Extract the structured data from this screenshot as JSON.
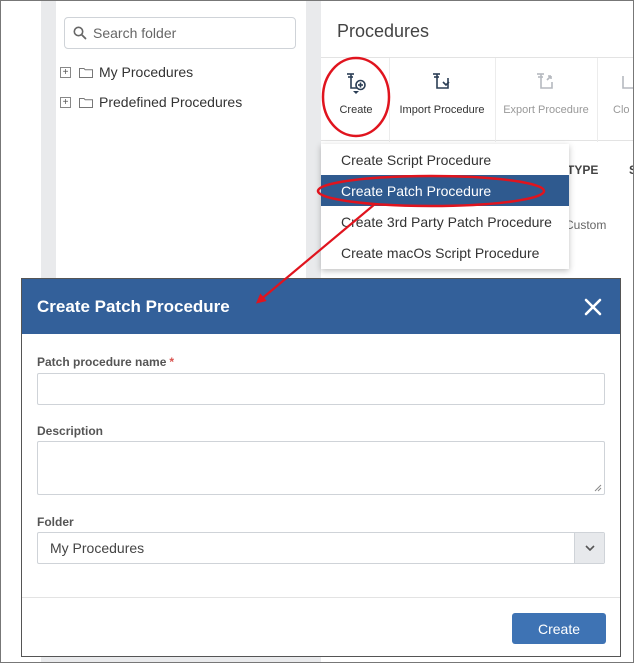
{
  "sidebar": {
    "search_placeholder": "Search folder",
    "tree": [
      {
        "label": "My Procedures",
        "expander": "+"
      },
      {
        "label": "Predefined Procedures",
        "expander": "+"
      }
    ]
  },
  "main": {
    "title": "Procedures",
    "toolbar": {
      "create": "Create",
      "import": "Import Procedure",
      "export": "Export Procedure",
      "clone": "Clo"
    },
    "columns": {
      "type": "TYPE",
      "next": "S"
    },
    "row_type": "Custom"
  },
  "dropdown": {
    "items": [
      "Create Script Procedure",
      "Create Patch Procedure",
      "Create 3rd Party Patch Procedure",
      "Create macOs Script Procedure"
    ],
    "active_index": 1
  },
  "modal": {
    "title": "Create Patch Procedure",
    "name_label": "Patch procedure name",
    "required_mark": "*",
    "name_value": "",
    "description_label": "Description",
    "description_value": "",
    "folder_label": "Folder",
    "folder_value": "My Procedures",
    "create_button": "Create"
  },
  "colors": {
    "header_blue": "#33609a",
    "active_item": "#2f5a8f",
    "button_blue": "#3e73b4",
    "annotation_red": "#e0141e"
  }
}
